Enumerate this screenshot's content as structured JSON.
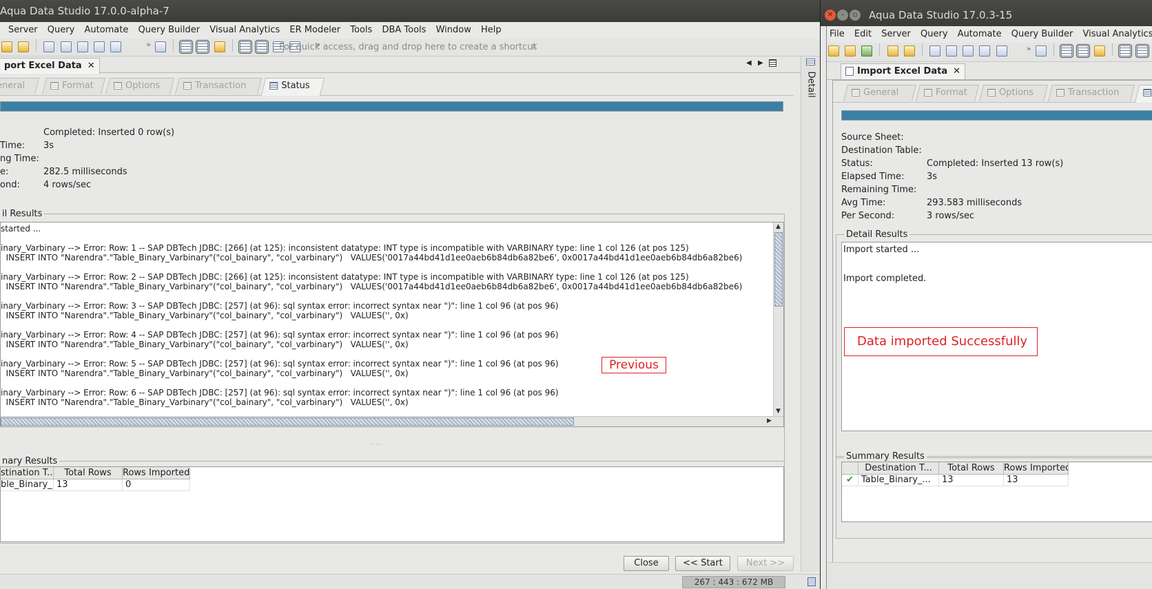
{
  "left": {
    "title": "Aqua Data Studio 17.0.0-alpha-7",
    "menu": [
      "Server",
      "Query",
      "Automate",
      "Query Builder",
      "Visual Analytics",
      "ER Modeler",
      "Tools",
      "DBA Tools",
      "Window",
      "Help"
    ],
    "quick_access_hint": "For quick access, drag and drop here to create a shortcut",
    "quick_access_close": "✕",
    "doc_tab": "port Excel Data",
    "doc_tab_close": "✕",
    "tabs": [
      "eneral",
      "Format",
      "Options",
      "Transaction",
      "Status"
    ],
    "progress": 1.0,
    "status_rows": [
      {
        "label": "",
        "value": "Completed: Inserted 0 row(s)"
      },
      {
        "label": "Time:",
        "value": "3s"
      },
      {
        "label": "ng Time:",
        "value": ""
      },
      {
        "label": "e:",
        "value": "282.5 milliseconds"
      },
      {
        "label": "ond:",
        "value": "4 rows/sec"
      }
    ],
    "detail_label": "il Results",
    "log_lines": [
      "started ...",
      "",
      "inary_Varbinary --> Error: Row: 1 -- SAP DBTech JDBC: [266] (at 125): inconsistent datatype: INT type is incompatible with VARBINARY type: line 1 col 126 (at pos 125)",
      "  INSERT INTO \"Narendra\".\"Table_Binary_Varbinary\"(\"col_bainary\", \"col_varbinary\")   VALUES('0017a44bd41d1ee0aeb6b84db6a82be6', 0x0017a44bd41d1ee0aeb6b84db6a82be6)",
      "",
      "inary_Varbinary --> Error: Row: 2 -- SAP DBTech JDBC: [266] (at 125): inconsistent datatype: INT type is incompatible with VARBINARY type: line 1 col 126 (at pos 125)",
      "  INSERT INTO \"Narendra\".\"Table_Binary_Varbinary\"(\"col_bainary\", \"col_varbinary\")   VALUES('0017a44bd41d1ee0aeb6b84db6a82be6', 0x0017a44bd41d1ee0aeb6b84db6a82be6)",
      "",
      "inary_Varbinary --> Error: Row: 3 -- SAP DBTech JDBC: [257] (at 96): sql syntax error: incorrect syntax near \")\": line 1 col 96 (at pos 96)",
      "  INSERT INTO \"Narendra\".\"Table_Binary_Varbinary\"(\"col_bainary\", \"col_varbinary\")   VALUES('', 0x)",
      "",
      "inary_Varbinary --> Error: Row: 4 -- SAP DBTech JDBC: [257] (at 96): sql syntax error: incorrect syntax near \")\": line 1 col 96 (at pos 96)",
      "  INSERT INTO \"Narendra\".\"Table_Binary_Varbinary\"(\"col_bainary\", \"col_varbinary\")   VALUES('', 0x)",
      "",
      "inary_Varbinary --> Error: Row: 5 -- SAP DBTech JDBC: [257] (at 96): sql syntax error: incorrect syntax near \")\": line 1 col 96 (at pos 96)",
      "  INSERT INTO \"Narendra\".\"Table_Binary_Varbinary\"(\"col_bainary\", \"col_varbinary\")   VALUES('', 0x)",
      "",
      "inary_Varbinary --> Error: Row: 6 -- SAP DBTech JDBC: [257] (at 96): sql syntax error: incorrect syntax near \")\": line 1 col 96 (at pos 96)",
      "  INSERT INTO \"Narendra\".\"Table_Binary_Varbinary\"(\"col_bainary\", \"col_varbinary\")   VALUES('', 0x)"
    ],
    "annotation": "Previous",
    "summary_label": "nary Results",
    "summary_headers": [
      "stination T...",
      "Total Rows",
      "Rows Imported"
    ],
    "summary_row": [
      "ble_Binary_...",
      "13",
      "0"
    ],
    "buttons": {
      "close": "Close",
      "start": "<< Start",
      "next": "Next >>"
    },
    "memory": "267 : 443 : 672 MB",
    "detail_side_label": "Detail"
  },
  "right": {
    "title": "Aqua Data Studio 17.0.3-15",
    "menu": [
      "File",
      "Edit",
      "Server",
      "Query",
      "Automate",
      "Query Builder",
      "Visual Analytics"
    ],
    "doc_tab": "Import Excel Data",
    "doc_tab_close": "✕",
    "tabs": [
      "General",
      "Format",
      "Options",
      "Transaction",
      "S"
    ],
    "progress": 1.0,
    "status_rows": [
      {
        "label": "Source Sheet:",
        "value": ""
      },
      {
        "label": "Destination Table:",
        "value": ""
      },
      {
        "label": "Status:",
        "value": "Completed: Inserted 13 row(s)"
      },
      {
        "label": "Elapsed Time:",
        "value": "3s"
      },
      {
        "label": "Remaining Time:",
        "value": ""
      },
      {
        "label": "Avg Time:",
        "value": "293.583 milliseconds"
      },
      {
        "label": "Per Second:",
        "value": "3 rows/sec"
      }
    ],
    "detail_label": "Detail Results",
    "log_lines": [
      "Import started ...",
      "",
      "",
      "Import completed."
    ],
    "annotation": "Data imported Successfully",
    "summary_label": "Summary Results",
    "summary_headers": [
      "Destination T...",
      "Total Rows",
      "Rows Imported"
    ],
    "summary_row": [
      "Table_Binary_...",
      "13",
      "13"
    ],
    "row_status_icon": "check-icon"
  },
  "colors": {
    "progress": "#3a7fa6",
    "annotation": "#e02020",
    "titlebar": "#3b3b38"
  }
}
